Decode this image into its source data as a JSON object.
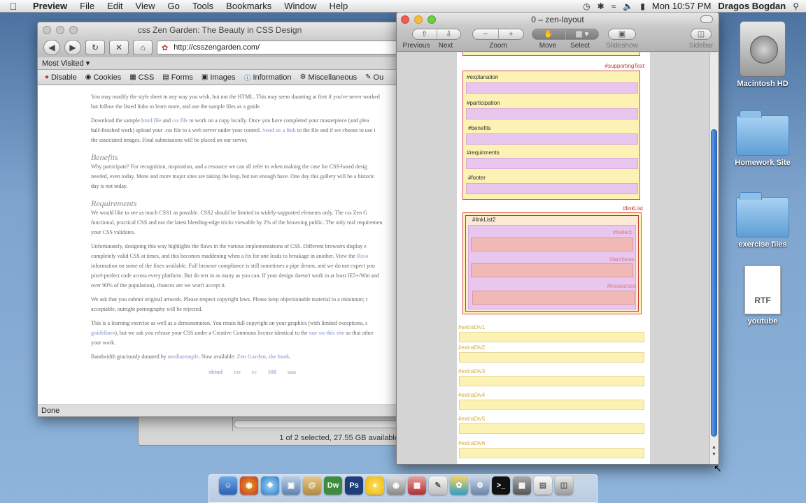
{
  "menubar": {
    "app": "Preview",
    "items": [
      "File",
      "Edit",
      "View",
      "Go",
      "Tools",
      "Bookmarks",
      "Window",
      "Help"
    ],
    "clock": "Mon 10:57 PM",
    "user": "Dragos Bogdan",
    "status_icons": [
      "time-machine-icon",
      "bluetooth-icon",
      "wifi-icon",
      "volume-icon",
      "battery-icon"
    ]
  },
  "desktop": {
    "items": [
      {
        "label": "Macintosh HD",
        "icon": "hard-drive-icon"
      },
      {
        "label": "Homework Site",
        "icon": "folder-icon"
      },
      {
        "label": "exercise files",
        "icon": "folder-icon"
      },
      {
        "label": "youtube",
        "icon": "rtf-document-icon",
        "badge": "RTF"
      }
    ]
  },
  "finder": {
    "status": "1 of 2 selected, 27.55 GB available"
  },
  "firefox": {
    "title": "css Zen Garden: The Beauty in CSS Design",
    "url": "http://csszengarden.com/",
    "bookmark": "Most Visited",
    "devbar": [
      "Disable",
      "Cookies",
      "CSS",
      "Forms",
      "Images",
      "Information",
      "Miscellaneous",
      "Ou"
    ],
    "status": "Done",
    "content": {
      "p1": "You may modify the style sheet in any way you wish, but not the HTML. This may seem daunting at first if you've never worked",
      "p1b": "but follow the listed links to learn more, and use the sample files as a guide.",
      "p2a": "Download the sample",
      "p2_link1": "html file",
      "p2_and": "and",
      "p2_link2": "css file",
      "p2b": "to work on a copy locally. Once you have completed your masterpiece (and plea",
      "p2c": "half-finished work) upload your .css file to a web server under your control.",
      "p2_link3": "Send us a link",
      "p2d": "to the file and if we choose to use i",
      "p2e": "the associated images. Final submissions will be placed on our server.",
      "h_benefits": "Benefits",
      "b1": "Why participate? For recognition, inspiration, and a resource we can all refer to when making the case for CSS-based desig",
      "b2": "needed, even today. More and more major sites are taking the leap, but not enough have. One day this gallery will be a historic",
      "b3": "day is not today.",
      "h_requirements": "Requirements",
      "r1": "We would like to see as much CSS1 as possible. CSS2 should be limited to widely-supported elements only. The css Zen G",
      "r2": "functional, practical CSS and not the latest bleeding-edge tricks viewable by 2% of the browsing public. The only real requiremen",
      "r3": "your CSS validates.",
      "r4": "Unfortunately, designing this way highlights the flaws in the various implementations of CSS. Different browsers display e",
      "r5a": "completely valid CSS at times, and this becomes maddening when a fix for one leads to breakage in another. View the",
      "r5_link": "Reso",
      "r6": "information on some of the fixes available. Full browser compliance is still sometimes a pipe dream, and we do not expect you",
      "r7": "pixel-perfect code across every platform. But do test in as many as you can. If your design doesn't work in at least IE5+/Win and",
      "r8": "over 90% of the population), chances are we won't accept it.",
      "r9": "We ask that you submit original artwork. Please respect copyright laws. Please keep objectionable material to a minimum; t",
      "r10": "acceptable, outright pornography will be rejected.",
      "r11": "This is a learning exercise as well as a demonstration. You retain full copyright on your graphics (with limited exceptions, s",
      "r12_link": "guidelines",
      "r12a": "), but we ask you release your CSS under a Creative Commons license identical to the",
      "r12_link2": "one on this site",
      "r12b": "so that other",
      "r13": "your work.",
      "bw_a": "Bandwidth graciously donated by",
      "bw_link": "mediatemple",
      "bw_b": ". Now available:",
      "bw_link2": "Zen Garden, the book",
      "bw_c": ".",
      "footer_links": [
        "xhtml",
        "css",
        "cc",
        "508",
        "aaa"
      ]
    }
  },
  "preview": {
    "title": "0 – zen-layout",
    "toolbar_labels": [
      "Previous",
      "Next",
      "Zoom",
      "Move",
      "Select",
      "Slideshow",
      "Sidebar"
    ],
    "layout": {
      "supportingText": "#supportingText",
      "sections": [
        "#explanation",
        "#participation",
        "#benefits",
        "#requirments",
        "#footer"
      ],
      "linkList": "#linkList",
      "linkList2": "#linkList2",
      "lists": [
        "#lselect",
        "#larchives",
        "#lresources"
      ],
      "extraDivs": [
        "#extraDiv1",
        "#extraDiv2",
        "#extraDiv3",
        "#extraDiv4",
        "#extraDiv5",
        "#extraDiv6"
      ]
    }
  },
  "dock": {
    "apps": [
      "finder-icon",
      "firefox-icon",
      "safari-icon",
      "preview-icon",
      "address-book-icon",
      "dreamweaver-icon",
      "photoshop-icon",
      "adium-icon",
      "image-capture-icon",
      "preview-document-icon",
      "textedit-icon",
      "fetch-icon",
      "system-preferences-icon",
      "terminal-icon",
      "utility-icon",
      "document-stack-icon",
      "trash-icon"
    ]
  }
}
